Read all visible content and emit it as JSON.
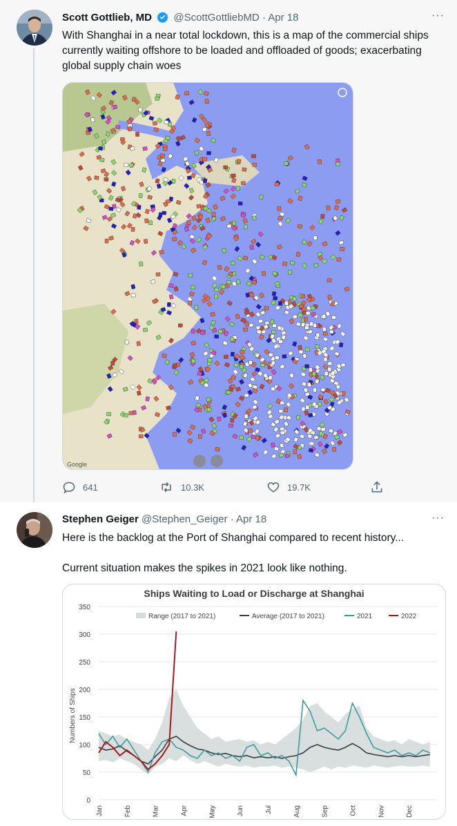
{
  "tweet1": {
    "author_name": "Scott Gottlieb, MD",
    "handle": "@ScottGottliebMD",
    "date": "Apr 18",
    "text": "With Shanghai in a near total lockdown, this is a map of the commercial ships currently waiting offshore to be loaded and offloaded of goods; exacerbating global supply chain woes",
    "media_icon": "ship-map-image",
    "map_logo": "Google",
    "replies": "641",
    "retweets": "10.3K",
    "likes": "19.7K",
    "more": "···"
  },
  "tweet2": {
    "author_name": "Stephen Geiger",
    "handle": "@Stephen_Geiger",
    "date": "Apr 18",
    "text_line1": "Here is the backlog at the Port of Shanghai compared to recent history...",
    "text_line2": "Current situation makes the spikes in 2021 look like nothing.",
    "more": "···"
  },
  "chart_data": {
    "type": "line",
    "title": "Ships Waiting to Load or Discharge at Shanghai",
    "ylabel": "Numbers of Ships",
    "xlabel": "",
    "ylim": [
      0,
      350
    ],
    "yticks": [
      "0",
      "50",
      "100",
      "150",
      "200",
      "250",
      "300",
      "350"
    ],
    "xticks": [
      "Jan",
      "Feb",
      "Mar",
      "Apr",
      "May",
      "Jun",
      "Jul",
      "Aug",
      "Sep",
      "Oct",
      "Nov",
      "Dec"
    ],
    "legend": [
      "Range (2017 to 2021)",
      "Average (2017 to 2021)",
      "2021",
      "2022"
    ],
    "legend_position": "top",
    "grid": true,
    "colors": {
      "range": "#d5dcdc",
      "average": "#3a3a3a",
      "y2021": "#3f9a9a",
      "y2022": "#a11a1a"
    },
    "x": [
      0,
      0.25,
      0.5,
      0.75,
      1,
      1.25,
      1.5,
      1.75,
      2,
      2.25,
      2.5,
      2.75,
      3,
      3.25,
      3.5,
      3.75,
      4,
      4.25,
      4.5,
      4.75,
      5,
      5.25,
      5.5,
      5.75,
      6,
      6.25,
      6.5,
      6.75,
      7,
      7.25,
      7.5,
      7.75,
      8,
      8.25,
      8.5,
      8.75,
      9,
      9.25,
      9.5,
      9.75,
      10,
      10.25,
      10.5,
      10.75,
      11,
      11.25,
      11.5,
      11.75
    ],
    "series": [
      {
        "name": "Range (2017 to 2021)",
        "kind": "range",
        "low": [
          70,
          72,
          68,
          75,
          70,
          65,
          55,
          45,
          60,
          65,
          75,
          70,
          80,
          72,
          65,
          70,
          65,
          60,
          65,
          62,
          60,
          62,
          58,
          60,
          60,
          62,
          58,
          60,
          58,
          55,
          50,
          55,
          60,
          55,
          60,
          58,
          62,
          60,
          58,
          62,
          60,
          58,
          60,
          62,
          60,
          60,
          62,
          60
        ],
        "high": [
          125,
          120,
          115,
          118,
          110,
          105,
          100,
          90,
          110,
          140,
          185,
          200,
          170,
          150,
          130,
          120,
          110,
          115,
          105,
          108,
          110,
          105,
          108,
          100,
          105,
          100,
          110,
          120,
          130,
          145,
          170,
          175,
          160,
          150,
          140,
          155,
          165,
          170,
          130,
          115,
          110,
          105,
          108,
          100,
          110,
          105,
          100,
          105
        ]
      },
      {
        "name": "Average (2017 to 2021)",
        "kind": "line",
        "values": [
          95,
          90,
          92,
          98,
          88,
          80,
          70,
          65,
          78,
          90,
          110,
          115,
          105,
          98,
          92,
          90,
          85,
          82,
          84,
          80,
          78,
          80,
          76,
          78,
          76,
          78,
          75,
          78,
          80,
          85,
          95,
          100,
          95,
          92,
          90,
          95,
          102,
          95,
          85,
          82,
          80,
          78,
          80,
          78,
          80,
          78,
          80,
          82
        ]
      },
      {
        "name": "2021",
        "kind": "line",
        "values": [
          120,
          100,
          115,
          95,
          110,
          90,
          70,
          50,
          85,
          105,
          110,
          95,
          90,
          80,
          75,
          90,
          80,
          85,
          75,
          80,
          70,
          95,
          100,
          80,
          85,
          75,
          80,
          70,
          45,
          180,
          160,
          125,
          130,
          120,
          110,
          125,
          175,
          150,
          120,
          95,
          90,
          85,
          90,
          80,
          85,
          80,
          90,
          85
        ]
      },
      {
        "name": "2022",
        "kind": "line",
        "values": [
          85,
          105,
          95,
          80,
          90,
          80,
          70,
          55,
          65,
          80,
          100,
          305
        ]
      }
    ]
  }
}
